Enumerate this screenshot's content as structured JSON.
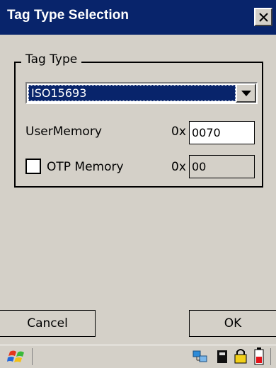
{
  "window": {
    "title": "Tag Type Selection"
  },
  "tag_type": {
    "group_label": "Tag Type",
    "selected": "ISO15693"
  },
  "user_memory": {
    "label": "UserMemory",
    "prefix": "0x",
    "value": "0070"
  },
  "otp_memory": {
    "label": "OTP Memory",
    "prefix": "0x",
    "value": "00",
    "checked": false
  },
  "buttons": {
    "cancel": "Cancel",
    "ok": "OK"
  },
  "taskbar": {
    "icons": [
      "windows-start-icon",
      "network-icon",
      "storage-card-icon",
      "lock-icon",
      "battery-icon"
    ]
  },
  "colors": {
    "titlebar": "#08246b",
    "face": "#d4d0c8",
    "selection": "#08246b"
  }
}
